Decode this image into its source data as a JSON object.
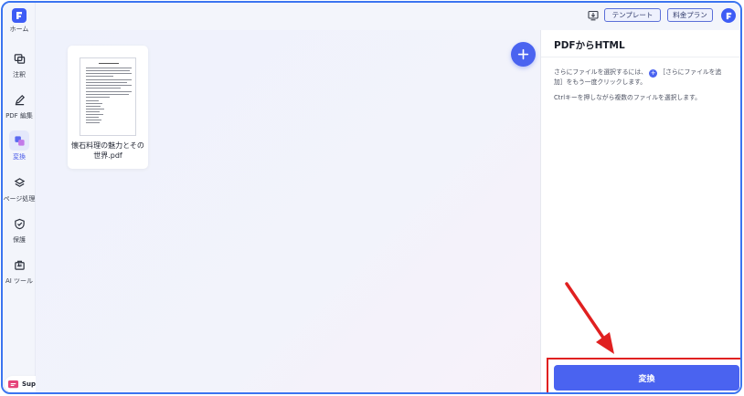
{
  "sidebar": {
    "logo_label": "ホーム",
    "items": [
      {
        "label": "注釈",
        "icon": "annotate-icon"
      },
      {
        "label": "PDF 編集",
        "icon": "edit-pen-icon"
      },
      {
        "label": "変換",
        "icon": "convert-icon",
        "active": true
      },
      {
        "label": "ページ処理",
        "icon": "layers-icon"
      },
      {
        "label": "保護",
        "icon": "shield-icon"
      },
      {
        "label": "AI ツール",
        "icon": "ai-toolbox-icon"
      }
    ],
    "support_label": "Support"
  },
  "topbar": {
    "template_label": "テンプレート",
    "pricing_label": "料金プラン"
  },
  "main": {
    "file": {
      "name": "懐石料理の魅力とその世界.pdf"
    }
  },
  "panel": {
    "title": "PDFからHTML",
    "hint1_before": "さらにファイルを選択するには、",
    "hint1_after": "［さらにファイルを追加］をもう一度クリックします。",
    "hint2": "Ctrlキーを押しながら複数のファイルを選択します。",
    "convert_label": "変換"
  },
  "colors": {
    "accent": "#4a63f0",
    "highlight": "#e02020"
  }
}
